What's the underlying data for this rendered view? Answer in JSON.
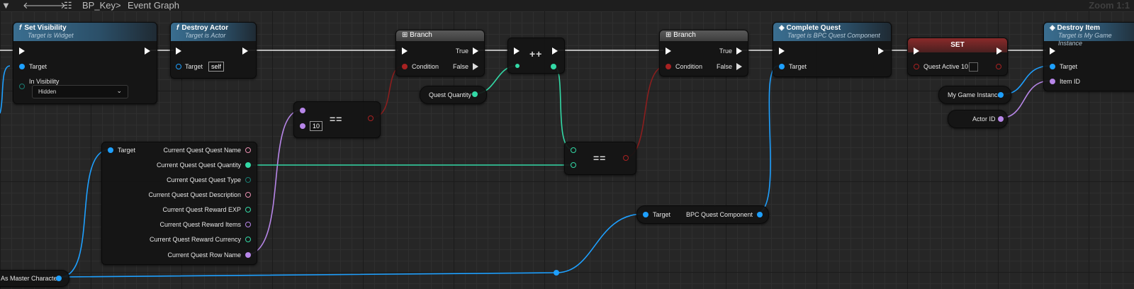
{
  "toolbar": {
    "breadcrumb_blueprint": "BP_Key",
    "breadcrumb_separator": ">",
    "breadcrumb_graph": "Event Graph",
    "zoom": "Zoom 1:1"
  },
  "nodes": {
    "set_visibility": {
      "title": "Set Visibility",
      "subtitle": "Target is Widget",
      "pin_target": "Target",
      "pin_in_visibility": "In Visibility",
      "visibility_value": "Hidden"
    },
    "destroy_actor": {
      "title": "Destroy Actor",
      "subtitle": "Target is Actor",
      "pin_target": "Target",
      "target_value": "self"
    },
    "branch1": {
      "title": "Branch",
      "pin_condition": "Condition",
      "pin_true": "True",
      "pin_false": "False"
    },
    "branch2": {
      "title": "Branch",
      "pin_condition": "Condition",
      "pin_true": "True",
      "pin_false": "False"
    },
    "increment": {
      "symbol": "++"
    },
    "equals1": {
      "symbol": "==",
      "literal": "10"
    },
    "equals2": {
      "symbol": "=="
    },
    "quest_quantity": {
      "label": "Quest Quantity"
    },
    "break_quest": {
      "pin_target": "Target",
      "outputs": [
        "Current Quest Quest Name",
        "Current Quest Quest Quantity",
        "Current Quest Quest Type",
        "Current Quest Quest Description",
        "Current Quest Reward EXP",
        "Current Quest Reward Items",
        "Current Quest Reward Currency",
        "Current Quest Row Name"
      ]
    },
    "master_character": {
      "label": "As Master Character"
    },
    "bpc_quest_getter": {
      "pin_target": "Target",
      "output": "BPC Quest Component"
    },
    "complete_quest": {
      "title": "Complete Quest",
      "subtitle": "Target is BPC Quest Component",
      "pin_target": "Target"
    },
    "set_node": {
      "title": "SET",
      "pin_label": "Quest Active 10"
    },
    "destroy_item": {
      "title": "Destroy Item",
      "subtitle": "Target is My Game Instance",
      "pin_target": "Target",
      "pin_item_id": "Item ID"
    },
    "my_game_instance": {
      "label": "My Game Instance"
    },
    "actor_id": {
      "label": "Actor ID"
    }
  },
  "colors": {
    "exec": "#ffffff",
    "object": "#1ea0ff",
    "integer": "#33d9a6",
    "boolean": "#a82222",
    "string": "#e88fb0",
    "name": "#b786e8",
    "byte": "#1a7c72",
    "header_function": "#3a6e90",
    "header_set": "#8a2a2a"
  },
  "icons": [
    "menu-icon",
    "back-arrow-icon",
    "forward-arrow-icon",
    "blueprint-hierarchy-icon",
    "function-icon",
    "branch-icon",
    "event-icon",
    "chevron-down-icon"
  ]
}
